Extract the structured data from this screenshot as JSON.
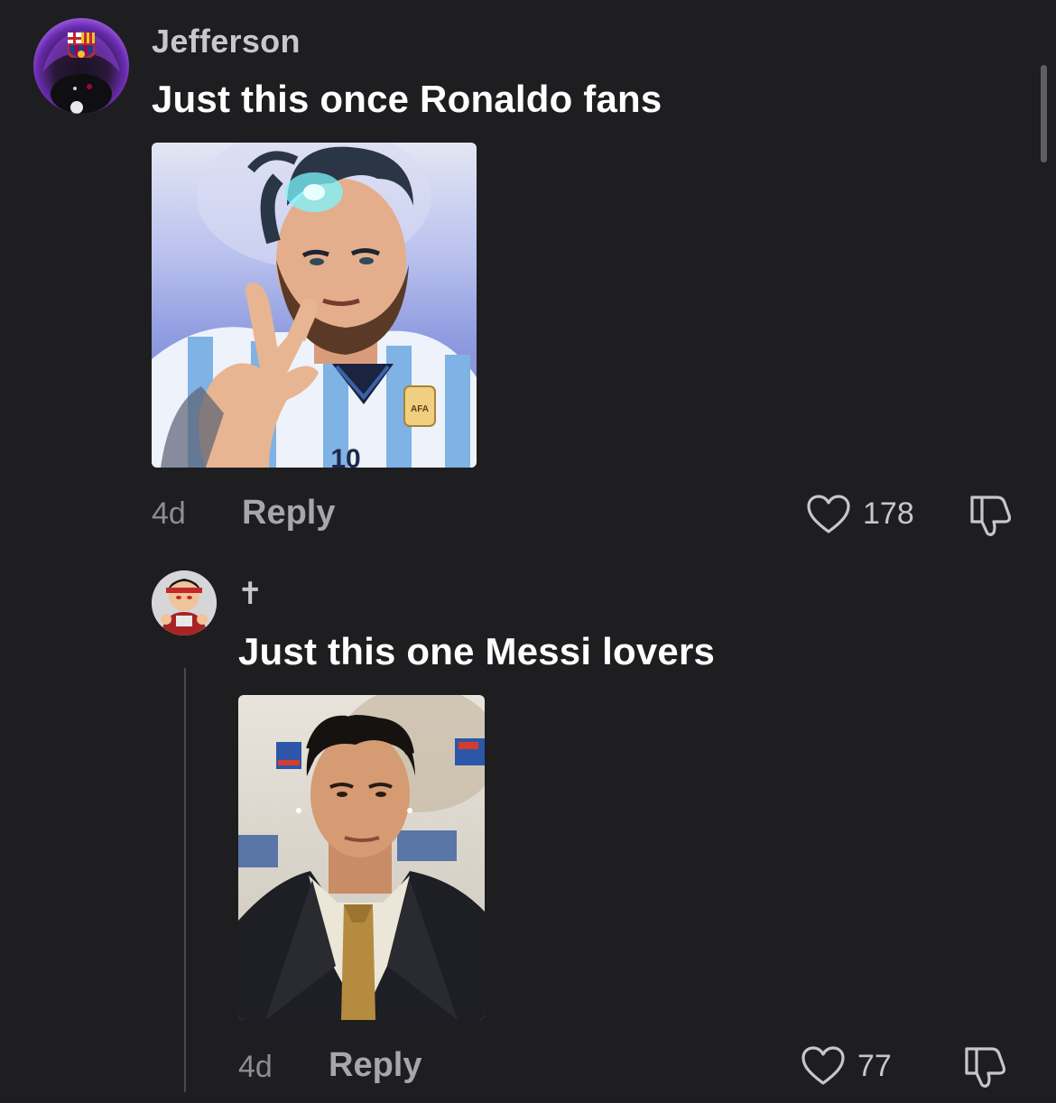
{
  "comments": [
    {
      "username": "Jefferson",
      "text": "Just this once Ronaldo fans",
      "time": "4d",
      "reply_label": "Reply",
      "likes": "178"
    },
    {
      "username": "✝",
      "text": "Just this one Messi lovers",
      "time": "4d",
      "reply_label": "Reply",
      "likes": "77"
    }
  ],
  "icons": {
    "like": "heart-outline-icon",
    "dislike": "thumbs-down-icon"
  },
  "colors": {
    "background": "#1e1e20",
    "username": "#c8c8cc",
    "text": "#ffffff",
    "muted": "#8d8d92"
  }
}
